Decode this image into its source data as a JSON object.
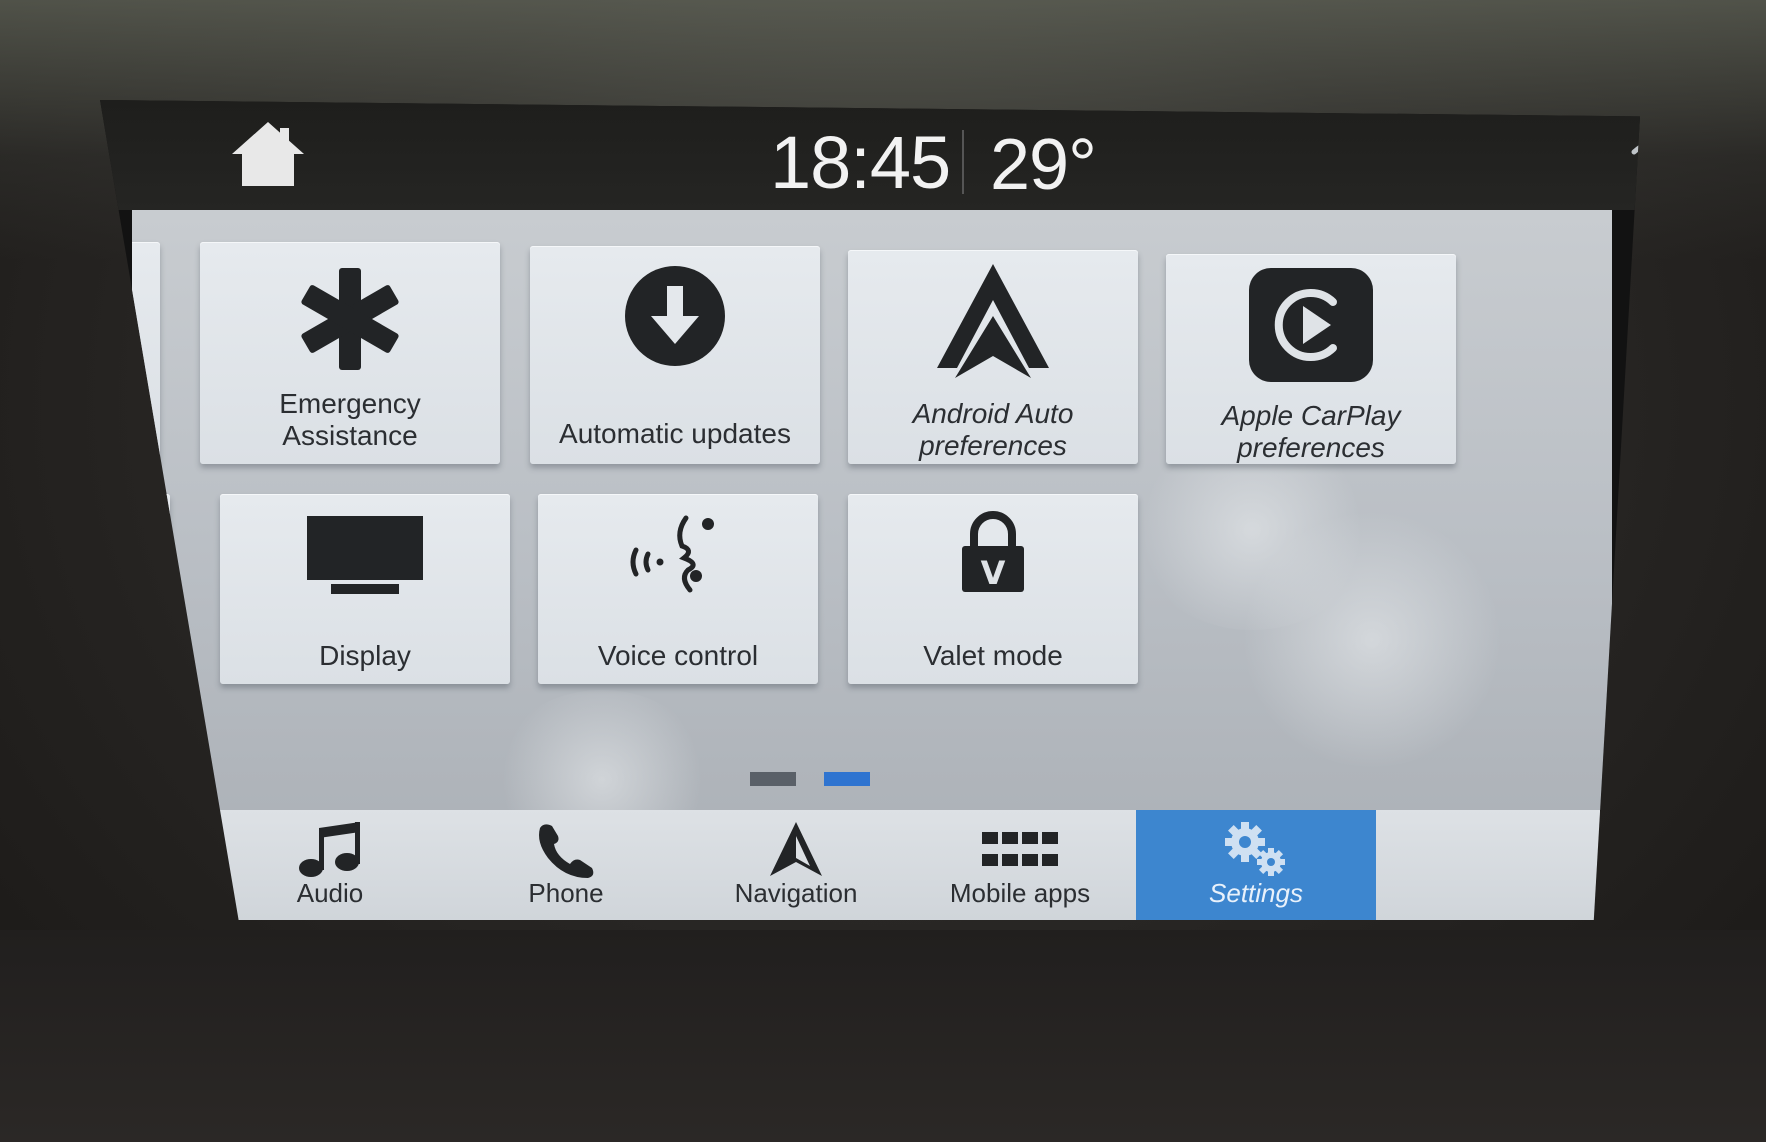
{
  "status": {
    "time": "18:45",
    "temperature": "29°"
  },
  "tiles": [
    {
      "id": "emergency",
      "lines": [
        "Emergency",
        "Assistance"
      ],
      "italic": false
    },
    {
      "id": "updates",
      "lines": [
        "Automatic updates"
      ],
      "italic": false
    },
    {
      "id": "android",
      "lines": [
        "Android Auto",
        "preferences"
      ],
      "italic": true
    },
    {
      "id": "carplay",
      "lines": [
        "Apple CarPlay",
        "preferences"
      ],
      "italic": true
    },
    {
      "id": "display",
      "lines": [
        "Display"
      ],
      "italic": false
    },
    {
      "id": "voice",
      "lines": [
        "Voice control"
      ],
      "italic": false
    },
    {
      "id": "valet",
      "lines": [
        "Valet mode"
      ],
      "italic": false
    }
  ],
  "pager": {
    "pages": 2,
    "current": 2,
    "inactive_color": "#5a6068",
    "active_color": "#2f74d0"
  },
  "nav": [
    {
      "id": "audio",
      "label": "Audio",
      "icon": "music-note-icon"
    },
    {
      "id": "phone",
      "label": "Phone",
      "icon": "phone-icon"
    },
    {
      "id": "navigation",
      "label": "Navigation",
      "icon": "navigation-arrow-icon"
    },
    {
      "id": "mobile_apps",
      "label": "Mobile apps",
      "icon": "app-grid-icon"
    },
    {
      "id": "settings",
      "label": "Settings",
      "icon": "gears-icon",
      "active": true
    }
  ],
  "colors": {
    "accent": "#3d86cf",
    "icon": "#222426"
  }
}
